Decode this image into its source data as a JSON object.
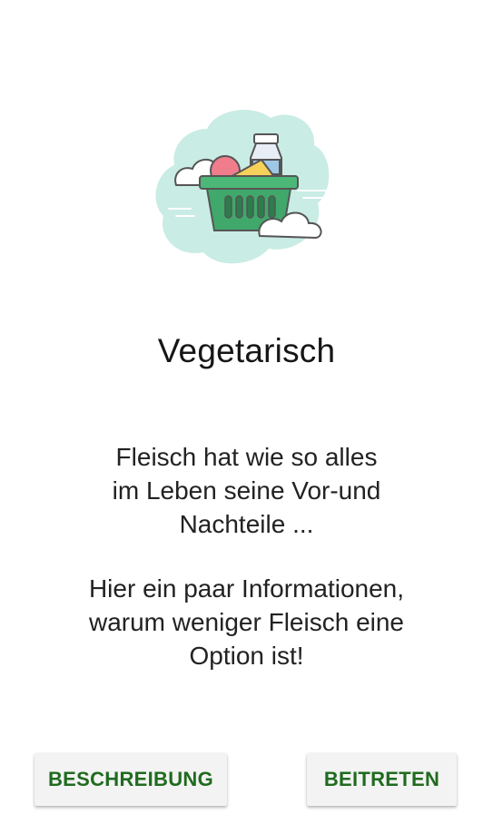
{
  "screen": {
    "illustration_icon": "grocery-basket-icon",
    "title": "Vegetarisch",
    "description_lines": [
      "Fleisch hat wie so alles",
      "im Leben seine Vor-und",
      "Nachteile ..."
    ],
    "info_lines": [
      "Hier ein paar Informationen,",
      "warum weniger Fleisch eine",
      "Option ist!"
    ]
  },
  "buttons": {
    "description_label": "BESCHREIBUNG",
    "join_label": "BEITRETEN"
  },
  "colors": {
    "accent_text": "#1f6b1f",
    "button_bg": "#f3f3f3",
    "basket_green": "#3fa86a",
    "cloud_bg": "#c9ece4"
  }
}
